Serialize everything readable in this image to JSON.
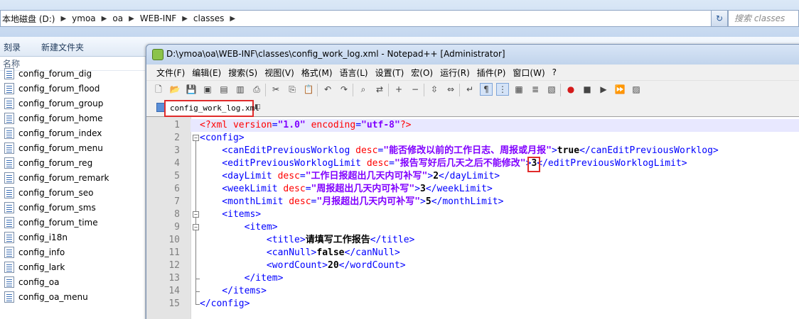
{
  "explorer": {
    "breadcrumb": [
      "本地磁盘 (D:)",
      "ymoa",
      "oa",
      "WEB-INF",
      "classes"
    ],
    "search_placeholder": "搜索 classes",
    "commands": [
      "刻录",
      "新建文件夹"
    ],
    "column_header": "名称",
    "files": [
      "config_forum_dig",
      "config_forum_flood",
      "config_forum_group",
      "config_forum_home",
      "config_forum_index",
      "config_forum_menu",
      "config_forum_reg",
      "config_forum_remark",
      "config_forum_seo",
      "config_forum_sms",
      "config_forum_time",
      "config_i18n",
      "config_info",
      "config_lark",
      "config_oa",
      "config_oa_menu"
    ]
  },
  "notepadpp": {
    "title": "D:\\ymoa\\oa\\WEB-INF\\classes\\config_work_log.xml - Notepad++ [Administrator]",
    "menu": [
      "文件(F)",
      "编辑(E)",
      "搜索(S)",
      "视图(V)",
      "格式(M)",
      "语言(L)",
      "设置(T)",
      "宏(O)",
      "运行(R)",
      "插件(P)",
      "窗口(W)",
      "?"
    ],
    "active_tab": "config_work_log.xml",
    "line_numbers": [
      "1",
      "2",
      "3",
      "4",
      "5",
      "6",
      "7",
      "8",
      "9",
      "10",
      "11",
      "12",
      "13",
      "14",
      "15"
    ],
    "code_lines": [
      [
        [
          "pi",
          "<?xml "
        ],
        [
          "attr",
          "version"
        ],
        [
          "tag",
          "="
        ],
        [
          "val",
          "\"1.0\""
        ],
        [
          "pi",
          " "
        ],
        [
          "attr",
          "encoding"
        ],
        [
          "tag",
          "="
        ],
        [
          "val",
          "\"utf-8\""
        ],
        [
          "pi",
          "?>"
        ]
      ],
      [
        [
          "tag",
          "<config>"
        ]
      ],
      [
        [
          "tag",
          "    <canEditPreviousWorklog "
        ],
        [
          "attr",
          "desc"
        ],
        [
          "tag",
          "="
        ],
        [
          "val",
          "\"能否修改以前的工作日志、周报或月报\""
        ],
        [
          "tag",
          ">"
        ],
        [
          "text",
          "true"
        ],
        [
          "tag",
          "</canEditPreviousWorklog>"
        ]
      ],
      [
        [
          "tag",
          "    <editPreviousWorklogLimit "
        ],
        [
          "attr",
          "desc"
        ],
        [
          "tag",
          "="
        ],
        [
          "val",
          "\"报告写好后几天之后不能修改\""
        ],
        [
          "tag",
          ">"
        ],
        [
          "text",
          "3"
        ],
        [
          "tag",
          "</editPreviousWorklogLimit>"
        ]
      ],
      [
        [
          "tag",
          "    <dayLimit "
        ],
        [
          "attr",
          "desc"
        ],
        [
          "tag",
          "="
        ],
        [
          "val",
          "\"工作日报超出几天内可补写\""
        ],
        [
          "tag",
          ">"
        ],
        [
          "text",
          "2"
        ],
        [
          "tag",
          "</dayLimit>"
        ]
      ],
      [
        [
          "tag",
          "    <weekLimit "
        ],
        [
          "attr",
          "desc"
        ],
        [
          "tag",
          "="
        ],
        [
          "val",
          "\"周报超出几天内可补写\""
        ],
        [
          "tag",
          ">"
        ],
        [
          "text",
          "3"
        ],
        [
          "tag",
          "</weekLimit>"
        ]
      ],
      [
        [
          "tag",
          "    <monthLimit "
        ],
        [
          "attr",
          "desc"
        ],
        [
          "tag",
          "="
        ],
        [
          "val",
          "\"月报超出几天内可补写\""
        ],
        [
          "tag",
          ">"
        ],
        [
          "text",
          "5"
        ],
        [
          "tag",
          "</monthLimit>"
        ]
      ],
      [
        [
          "tag",
          "    <items>"
        ]
      ],
      [
        [
          "tag",
          "        <item>"
        ]
      ],
      [
        [
          "tag",
          "            <title>"
        ],
        [
          "text",
          "请填写工作报告"
        ],
        [
          "tag",
          "</title>"
        ]
      ],
      [
        [
          "tag",
          "            <canNull>"
        ],
        [
          "text",
          "false"
        ],
        [
          "tag",
          "</canNull>"
        ]
      ],
      [
        [
          "tag",
          "            <wordCount>"
        ],
        [
          "text",
          "20"
        ],
        [
          "tag",
          "</wordCount>"
        ]
      ],
      [
        [
          "tag",
          "        </item>"
        ]
      ],
      [
        [
          "tag",
          "    </items>"
        ]
      ],
      [
        [
          "tag",
          "</config>"
        ]
      ]
    ],
    "toolbar_icons": [
      "new-file-icon",
      "open-file-icon",
      "save-icon",
      "save-all-icon",
      "close-icon",
      "close-all-icon",
      "print-icon",
      "cut-icon",
      "copy-icon",
      "paste-icon",
      "undo-icon",
      "redo-icon",
      "find-icon",
      "replace-icon",
      "zoom-in-icon",
      "zoom-out-icon",
      "sync-vertical-icon",
      "sync-horizontal-icon",
      "word-wrap-icon",
      "show-all-chars-icon",
      "indent-guide-icon",
      "doc-map-icon",
      "function-list-icon",
      "folder-workspace-icon",
      "record-macro-icon",
      "stop-macro-icon",
      "play-macro-icon",
      "run-macro-multiple-icon",
      "save-macro-icon"
    ],
    "colors": {
      "pi": "#ff0000",
      "tag": "#0000ff",
      "attr": "#ff0000",
      "value": "#8000ff",
      "highlight": "#e8e8ff",
      "annotation_box": "#e02b2b"
    }
  }
}
